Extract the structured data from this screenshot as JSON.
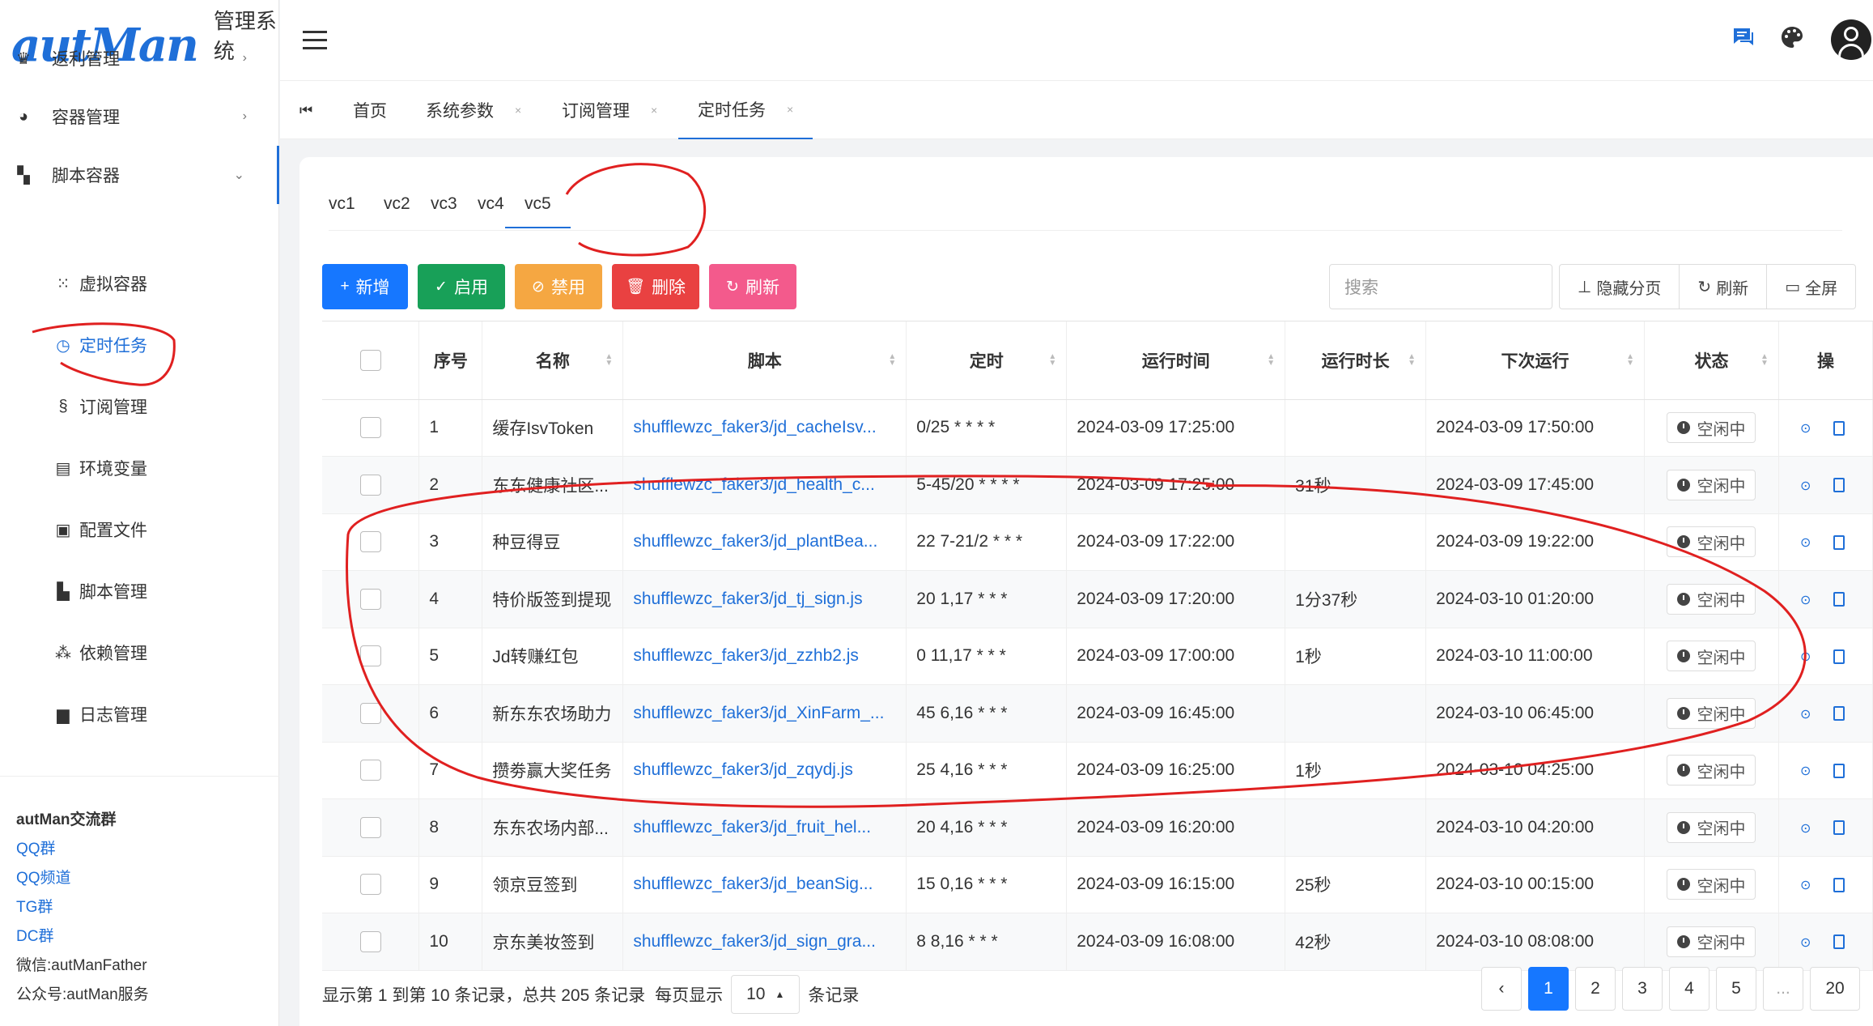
{
  "app": {
    "logo": "autMan",
    "title": "管理系统"
  },
  "sidebar": {
    "top_items": [
      {
        "label": "返利管理",
        "icon": "crown-icon",
        "chev": "›"
      },
      {
        "label": "容器管理",
        "icon": "cookie-icon",
        "chev": "›"
      },
      {
        "label": "脚本容器",
        "icon": "dashboard-icon",
        "chev": "⌄"
      }
    ],
    "sub_items": [
      {
        "label": "虚拟容器",
        "icon": "dots-icon",
        "glyph": "⁙"
      },
      {
        "label": "定时任务",
        "icon": "clock-calendar-icon",
        "glyph": "◷"
      },
      {
        "label": "订阅管理",
        "icon": "section-icon",
        "glyph": "§"
      },
      {
        "label": "环境变量",
        "icon": "monitor-icon",
        "glyph": "▤"
      },
      {
        "label": "配置文件",
        "icon": "tc-icon",
        "glyph": "▣"
      },
      {
        "label": "脚本管理",
        "icon": "book-icon",
        "glyph": "▙"
      },
      {
        "label": "依赖管理",
        "icon": "connect-icon",
        "glyph": "⁂"
      },
      {
        "label": "日志管理",
        "icon": "file-icon",
        "glyph": "▆"
      }
    ],
    "group": {
      "title": "autMan交流群",
      "links": [
        "QQ群",
        "QQ频道",
        "TG群",
        "DC群"
      ],
      "texts": [
        "微信:autManFather",
        "公众号:autMan服务"
      ]
    }
  },
  "tabs": {
    "items": [
      {
        "label": "首页",
        "closable": false
      },
      {
        "label": "系统参数",
        "closable": true
      },
      {
        "label": "订阅管理",
        "closable": true
      },
      {
        "label": "定时任务",
        "closable": true,
        "active": true
      }
    ],
    "close_glyph": "×"
  },
  "subtabs": [
    "vc1",
    "vc2",
    "vc3",
    "vc4",
    "vc5"
  ],
  "toolbar": {
    "buttons": [
      {
        "label": "新增",
        "icon": "plus-icon",
        "glyph": "+",
        "color": "#1677ff"
      },
      {
        "label": "启用",
        "icon": "check-icon",
        "glyph": "✓",
        "color": "#18a058"
      },
      {
        "label": "禁用",
        "icon": "ban-icon",
        "glyph": "⊘",
        "color": "#f5a742"
      },
      {
        "label": "删除",
        "icon": "trash-icon",
        "glyph": "🗑",
        "color": "#e94141"
      },
      {
        "label": "刷新",
        "icon": "refresh-icon",
        "glyph": "↻",
        "color": "#f35a8c"
      }
    ],
    "search_placeholder": "搜索",
    "tools": [
      {
        "label": "隐藏分页",
        "icon": "pin-icon",
        "glyph": "⊥"
      },
      {
        "label": "刷新",
        "icon": "refresh-icon",
        "glyph": "↻"
      },
      {
        "label": "全屏",
        "icon": "monitor-icon",
        "glyph": "▭"
      }
    ]
  },
  "table": {
    "headers": [
      "序号",
      "名称",
      "脚本",
      "定时",
      "运行时间",
      "运行时长",
      "下次运行",
      "状态",
      "操"
    ],
    "rows": [
      {
        "no": "1",
        "name": "缓存IsvToken",
        "script": "shufflewzc_faker3/jd_cacheIsv...",
        "cron": "0/25 * * * *",
        "run_time": "2024-03-09 17:25:00",
        "duration": "",
        "next": "2024-03-09 17:50:00",
        "status": "空闲中"
      },
      {
        "no": "2",
        "name": "东东健康社区...",
        "script": "shufflewzc_faker3/jd_health_c...",
        "cron": "5-45/20 * * * *",
        "run_time": "2024-03-09 17:25:00",
        "duration": "31秒",
        "next": "2024-03-09 17:45:00",
        "status": "空闲中"
      },
      {
        "no": "3",
        "name": "种豆得豆",
        "script": "shufflewzc_faker3/jd_plantBea...",
        "cron": "22 7-21/2 * * *",
        "run_time": "2024-03-09 17:22:00",
        "duration": "",
        "next": "2024-03-09 19:22:00",
        "status": "空闲中"
      },
      {
        "no": "4",
        "name": "特价版签到提现",
        "script": "shufflewzc_faker3/jd_tj_sign.js",
        "cron": "20 1,17 * * *",
        "run_time": "2024-03-09 17:20:00",
        "duration": "1分37秒",
        "next": "2024-03-10 01:20:00",
        "status": "空闲中"
      },
      {
        "no": "5",
        "name": "Jd转赚红包",
        "script": "shufflewzc_faker3/jd_zzhb2.js",
        "cron": "0 11,17 * * *",
        "run_time": "2024-03-09 17:00:00",
        "duration": "1秒",
        "next": "2024-03-10 11:00:00",
        "status": "空闲中"
      },
      {
        "no": "6",
        "name": "新东东农场助力",
        "script": "shufflewzc_faker3/jd_XinFarm_...",
        "cron": "45 6,16 * * *",
        "run_time": "2024-03-09 16:45:00",
        "duration": "",
        "next": "2024-03-10 06:45:00",
        "status": "空闲中"
      },
      {
        "no": "7",
        "name": "攒劵赢大奖任务",
        "script": "shufflewzc_faker3/jd_zqydj.js",
        "cron": "25 4,16 * * *",
        "run_time": "2024-03-09 16:25:00",
        "duration": "1秒",
        "next": "2024-03-10 04:25:00",
        "status": "空闲中"
      },
      {
        "no": "8",
        "name": "东东农场内部...",
        "script": "shufflewzc_faker3/jd_fruit_hel...",
        "cron": "20 4,16 * * *",
        "run_time": "2024-03-09 16:20:00",
        "duration": "",
        "next": "2024-03-10 04:20:00",
        "status": "空闲中"
      },
      {
        "no": "9",
        "name": "领京豆签到",
        "script": "shufflewzc_faker3/jd_beanSig...",
        "cron": "15 0,16 * * *",
        "run_time": "2024-03-09 16:15:00",
        "duration": "25秒",
        "next": "2024-03-10 00:15:00",
        "status": "空闲中"
      },
      {
        "no": "10",
        "name": "京东美妆签到",
        "script": "shufflewzc_faker3/jd_sign_gra...",
        "cron": "8 8,16 * * *",
        "run_time": "2024-03-09 16:08:00",
        "duration": "42秒",
        "next": "2024-03-10 08:08:00",
        "status": "空闲中"
      }
    ]
  },
  "footer": {
    "summary": "显示第 1 到第 10 条记录，总共 205 条记录",
    "per_page_prefix": "每页显示",
    "per_page_value": "10",
    "per_page_suffix": "条记录",
    "pages": [
      "‹",
      "1",
      "2",
      "3",
      "4",
      "5",
      "...",
      "20"
    ],
    "active_page": "1"
  },
  "colors": {
    "accent": "#1f6fd8",
    "annotation": "#e02020"
  }
}
